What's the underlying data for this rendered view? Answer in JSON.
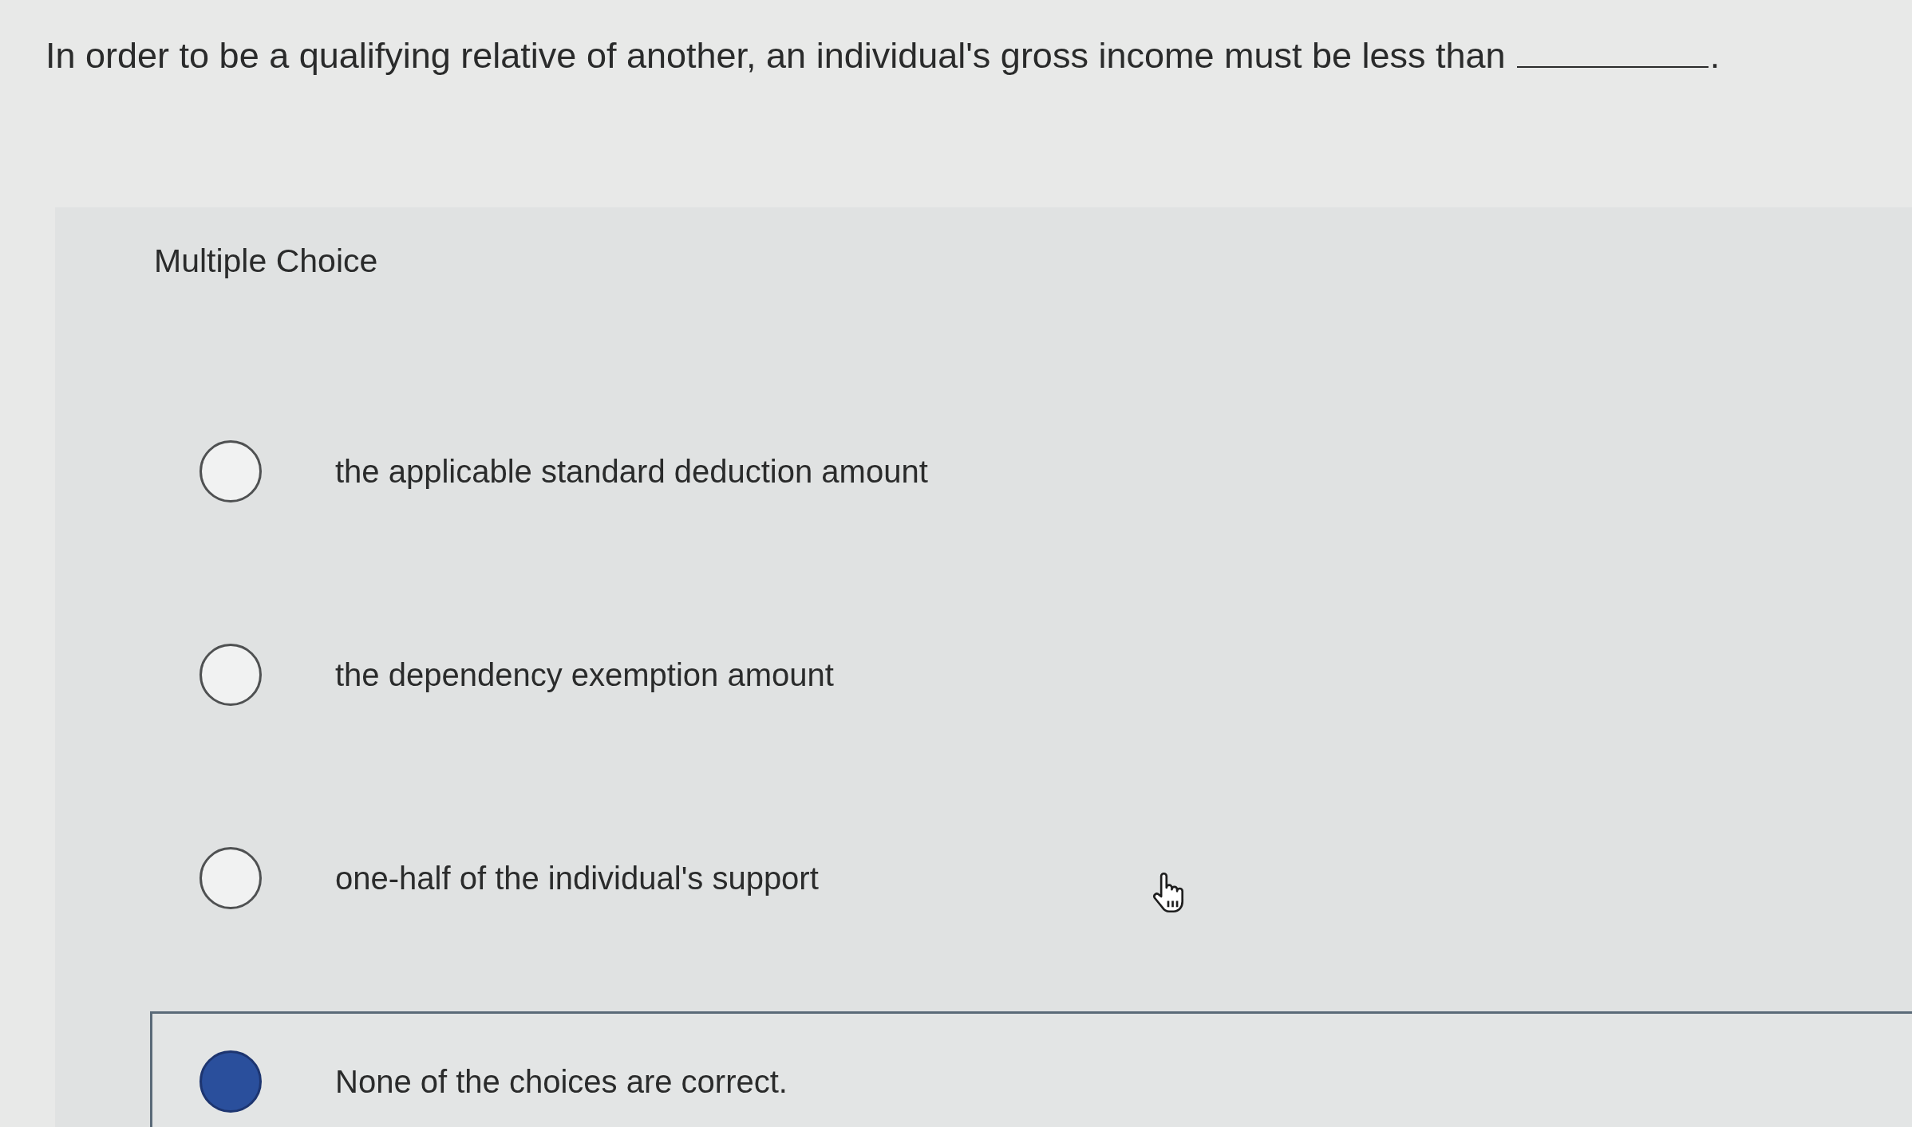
{
  "question": {
    "text": "In order to be a qualifying relative of another, an individual's gross income must be less than",
    "after_blank": "."
  },
  "multiple_choice": {
    "heading": "Multiple Choice",
    "options": [
      {
        "label": "the applicable standard deduction amount",
        "selected": false
      },
      {
        "label": "the dependency exemption amount",
        "selected": false
      },
      {
        "label": "one-half of the individual's support",
        "selected": false
      },
      {
        "label": "None of the choices are correct.",
        "selected": true
      }
    ]
  }
}
